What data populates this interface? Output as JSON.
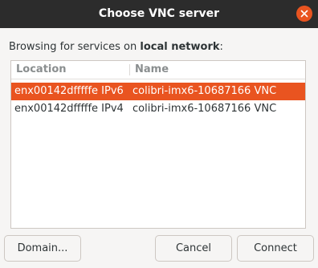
{
  "window": {
    "title": "Choose VNC server"
  },
  "browse": {
    "prefix": "Browsing for services on ",
    "network": "local network",
    "suffix": ":"
  },
  "table": {
    "columns": [
      "Location",
      "Name"
    ],
    "rows": [
      {
        "location": "enx00142dfffffe IPv6",
        "name": "colibri-imx6-10687166 VNC",
        "selected": true
      },
      {
        "location": "enx00142dfffffe IPv4",
        "name": "colibri-imx6-10687166 VNC",
        "selected": false
      }
    ]
  },
  "buttons": {
    "domain": "Domain...",
    "cancel": "Cancel",
    "connect": "Connect"
  },
  "colors": {
    "accent": "#e95420",
    "titlebar": "#2c2c2c",
    "background": "#f6f5f4"
  }
}
